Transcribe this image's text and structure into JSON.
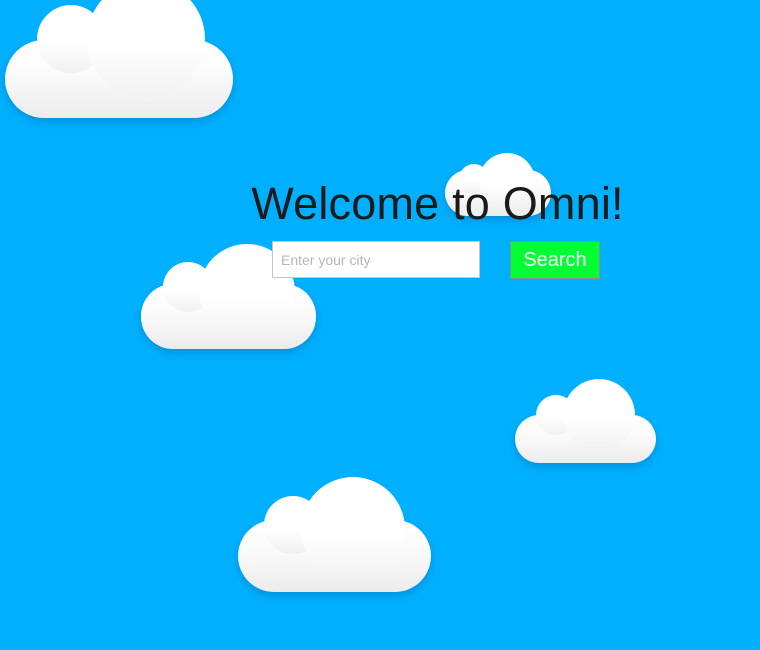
{
  "page": {
    "background_color": "#00b0ff",
    "title": "Welcome to Omni!"
  },
  "search": {
    "placeholder": "Enter your city",
    "value": "",
    "button_label": "Search",
    "button_color": "#00ff33"
  },
  "decorations": {
    "cloud_color": "#ffffff",
    "cloud_count": 5
  }
}
